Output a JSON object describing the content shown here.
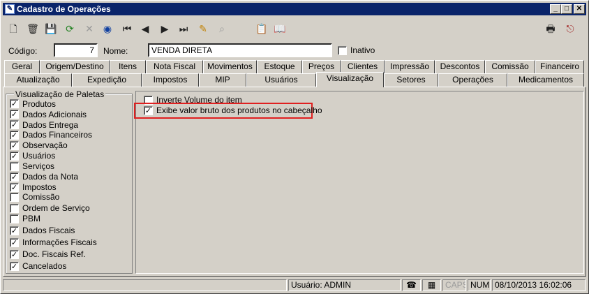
{
  "window": {
    "title": "Cadastro de Operações",
    "icon": "app-icon"
  },
  "toolbar": {
    "icons": [
      "new-document-icon",
      "delete-icon",
      "save-icon",
      "refresh-icon",
      "cancel-icon",
      "search-icon",
      "first-record-icon",
      "previous-record-icon",
      "next-record-icon",
      "last-record-icon",
      "filter-icon",
      "find-icon",
      "copy-icon",
      "book-icon",
      "print-icon",
      "exit-icon"
    ]
  },
  "form": {
    "codigo_label": "Código:",
    "codigo_value": "7",
    "nome_label": "Nome:",
    "nome_value": "VENDA DIRETA",
    "inativo_label": "Inativo"
  },
  "tabs_row1": [
    "Geral",
    "Origem/Destino",
    "Itens",
    "Nota Fiscal",
    "Movimentos",
    "Estoque",
    "Preços",
    "Clientes",
    "Impressão",
    "Descontos",
    "Comissão",
    "Financeiro"
  ],
  "tabs_row2": [
    "Atualização",
    "Expedição",
    "Impostos",
    "MIP",
    "Usuários",
    "Visualização",
    "Setores",
    "Operações",
    "Medicamentos"
  ],
  "active_tab": "Visualização",
  "paletas": {
    "title": "Visualização de Paletas",
    "items": [
      {
        "label": "Produtos",
        "checked": true
      },
      {
        "label": "Dados Adicionais",
        "checked": true
      },
      {
        "label": "Dados Entrega",
        "checked": true
      },
      {
        "label": "Dados Financeiros",
        "checked": true
      },
      {
        "label": "Observação",
        "checked": true
      },
      {
        "label": "Usuários",
        "checked": true
      },
      {
        "label": "Serviços",
        "checked": false
      },
      {
        "label": "Dados da Nota",
        "checked": true
      },
      {
        "label": "Impostos",
        "checked": true
      },
      {
        "label": "Comissão",
        "checked": false
      },
      {
        "label": "Ordem de Serviço",
        "checked": false
      },
      {
        "label": "PBM",
        "checked": false
      },
      {
        "label": "Dados Fiscais",
        "checked": true
      },
      {
        "label": "Informações Fiscais",
        "checked": true
      },
      {
        "label": "Doc. Fiscais Ref.",
        "checked": true
      },
      {
        "label": "Cancelados",
        "checked": true
      }
    ]
  },
  "options": [
    {
      "label": "Inverte Volume do item",
      "checked": false
    },
    {
      "label": "Exibe valor bruto dos produtos no cabeçalho",
      "checked": true
    }
  ],
  "statusbar": {
    "usuario": "Usuário: ADMIN",
    "caps": "CAPS",
    "num": "NUM",
    "datetime": "08/10/2013 16:02:06"
  }
}
